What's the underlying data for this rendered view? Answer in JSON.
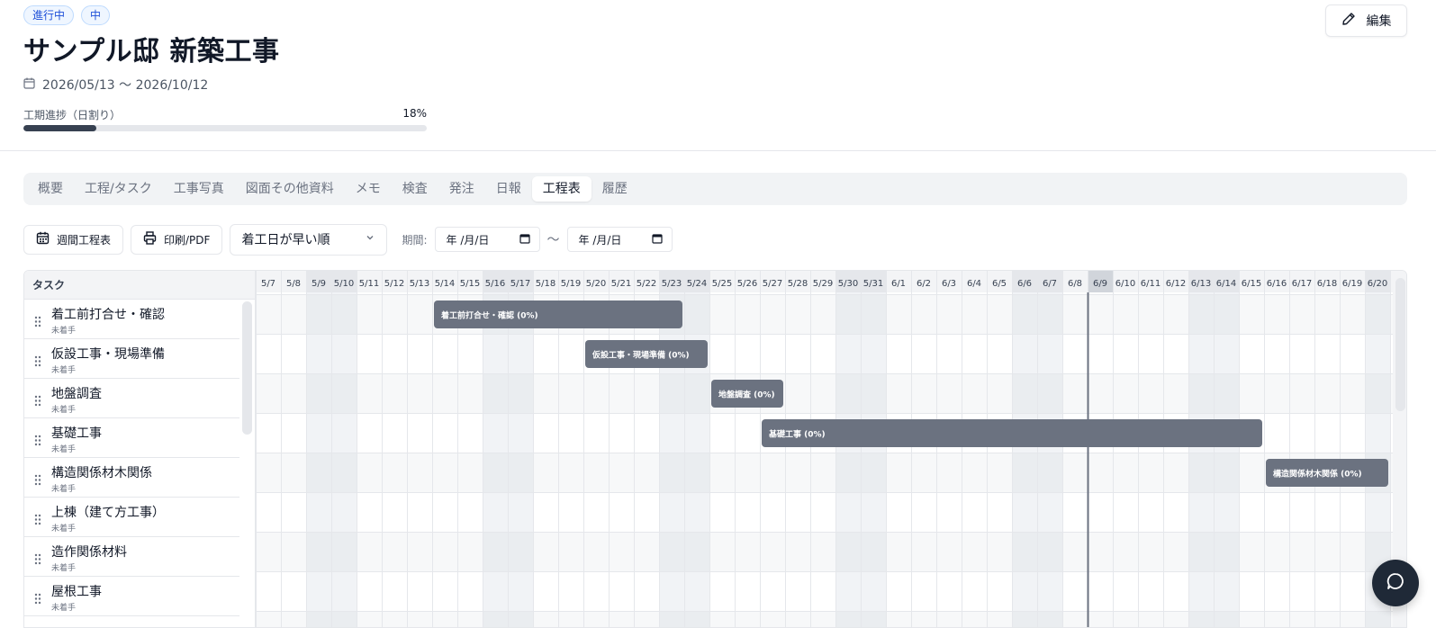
{
  "header": {
    "badges": [
      "進行中",
      "中"
    ],
    "title": "サンプル邸 新築工事",
    "date_range": "2026/05/13 〜 2026/10/12",
    "edit_label": "編集",
    "progress_label": "工期進捗（日割り）",
    "progress_text": "18%",
    "progress_value": 0.18
  },
  "tabs": [
    {
      "label": "概要"
    },
    {
      "label": "工程/タスク"
    },
    {
      "label": "工事写真"
    },
    {
      "label": "図面その他資料"
    },
    {
      "label": "メモ"
    },
    {
      "label": "検査"
    },
    {
      "label": "発注"
    },
    {
      "label": "日報"
    },
    {
      "label": "工程表",
      "active": true
    },
    {
      "label": "履歴"
    }
  ],
  "toolbar": {
    "weekly_label": "週間工程表",
    "print_label": "印刷/PDF",
    "sort_value": "着工日が早い順",
    "period_label": "期間:",
    "date_placeholder": "年 /月/日",
    "tilde": "〜"
  },
  "gantt": {
    "task_header": "タスク",
    "days": [
      "5/7",
      "5/8",
      "5/9",
      "5/10",
      "5/11",
      "5/12",
      "5/13",
      "5/14",
      "5/15",
      "5/16",
      "5/17",
      "5/18",
      "5/19",
      "5/20",
      "5/21",
      "5/22",
      "5/23",
      "5/24",
      "5/25",
      "5/26",
      "5/27",
      "5/28",
      "5/29",
      "5/30",
      "5/31",
      "6/1",
      "6/2",
      "6/3",
      "6/4",
      "6/5",
      "6/6",
      "6/7",
      "6/8",
      "6/9",
      "6/10",
      "6/11",
      "6/12",
      "6/13",
      "6/14",
      "6/15",
      "6/16",
      "6/17",
      "6/18",
      "6/19",
      "6/20"
    ],
    "weekend_days": [
      "5/9",
      "5/10",
      "5/16",
      "5/17",
      "5/23",
      "5/24",
      "5/30",
      "5/31",
      "6/6",
      "6/7",
      "6/13",
      "6/14",
      "6/20"
    ],
    "today": "6/9",
    "tasks": [
      {
        "name": "着工前打合せ・確認",
        "status": "未着手",
        "bar_label": "着工前打合せ・確認 (0%)",
        "start": "5/14",
        "end": "5/23"
      },
      {
        "name": "仮設工事・現場準備",
        "status": "未着手",
        "bar_label": "仮設工事・現場準備 (0%)",
        "start": "5/20",
        "end": "5/24"
      },
      {
        "name": "地盤調査",
        "status": "未着手",
        "bar_label": "地盤調査 (0%)",
        "start": "5/25",
        "end": "5/27"
      },
      {
        "name": "基礎工事",
        "status": "未着手",
        "bar_label": "基礎工事 (0%)",
        "start": "5/27",
        "end": "6/15"
      },
      {
        "name": "構造関係材木関係",
        "status": "未着手",
        "bar_label": "構造関係材木関係 (0%)",
        "start": "6/16",
        "end": "6/20"
      },
      {
        "name": "上棟（建て方工事）",
        "status": "未着手"
      },
      {
        "name": "造作関係材料",
        "status": "未着手"
      },
      {
        "name": "屋根工事",
        "status": "未着手"
      }
    ]
  }
}
